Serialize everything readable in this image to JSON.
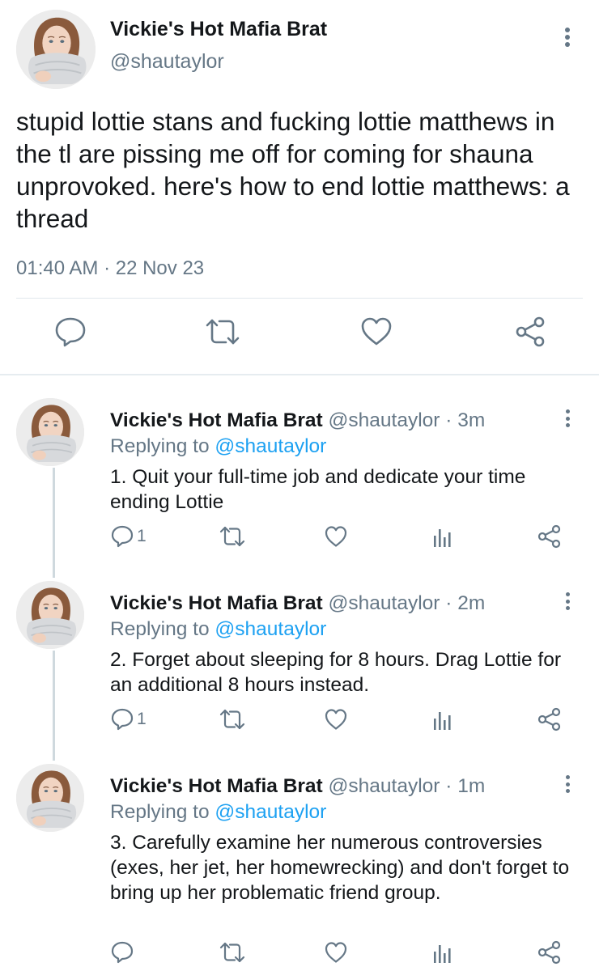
{
  "main_tweet": {
    "display_name": "Vickie's Hot Mafia Brat",
    "handle": "@shautaylor",
    "text": "stupid lottie stans and fucking lottie matthews in the tl are pissing me off for coming for shauna unprovoked. here's how to end lottie matthews: a thread",
    "timestamp": "01:40 AM · 22 Nov 23",
    "actions": [
      "reply-icon",
      "retweet-icon",
      "like-icon",
      "share-icon"
    ]
  },
  "replies": [
    {
      "display_name": "Vickie's Hot Mafia Brat",
      "meta": "@shautaylor · 3m",
      "replying_prefix": "Replying to ",
      "replying_to": "@shautaylor",
      "text": "1. Quit your full-time job and dedicate your time ending Lottie",
      "reply_count": "1"
    },
    {
      "display_name": "Vickie's Hot Mafia Brat",
      "meta": "@shautaylor · 2m",
      "replying_prefix": "Replying to ",
      "replying_to": "@shautaylor",
      "text": "2. Forget about sleeping for 8 hours. Drag Lottie for an additional 8 hours instead.",
      "reply_count": "1"
    },
    {
      "display_name": "Vickie's Hot Mafia Brat",
      "meta": "@shautaylor · 1m",
      "replying_prefix": "Replying to ",
      "replying_to": "@shautaylor",
      "text": "3. Carefully examine her numerous controversies (exes, her jet, her homewrecking) and don't forget to bring up her problematic friend group.",
      "reply_count": ""
    }
  ],
  "colors": {
    "text": "#14171a",
    "muted": "#657786",
    "link": "#1da1f2",
    "divider": "#e1e8ed"
  }
}
